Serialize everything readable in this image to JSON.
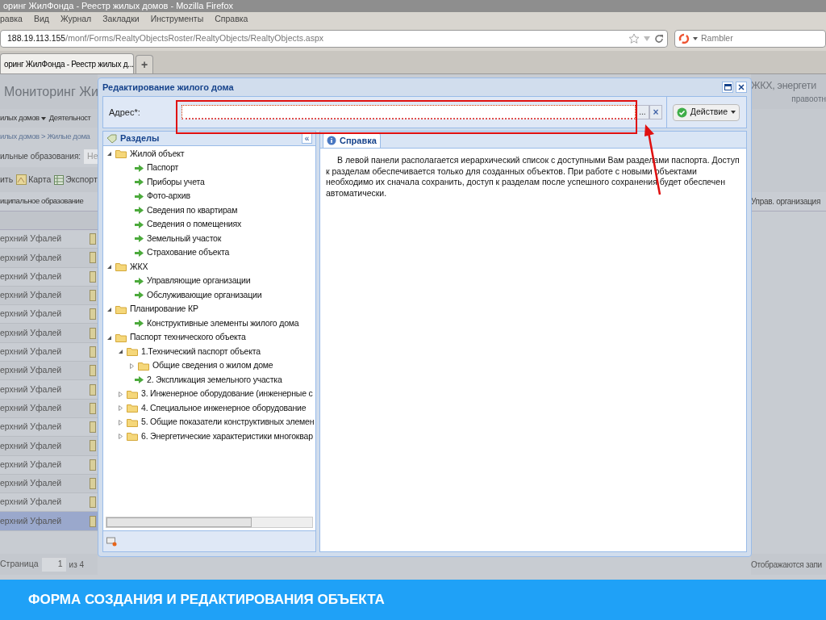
{
  "browser": {
    "title": "оринг ЖилФонда - Реестр жилых домов - Mozilla Firefox",
    "menu": [
      "равка",
      "Вид",
      "Журнал",
      "Закладки",
      "Инструменты",
      "Справка"
    ],
    "address": {
      "host": "188.19.113.155",
      "path": "/monf/Forms/RealtyObjectsRoster/RealtyObjects/RealtyObjects.aspx"
    },
    "search": {
      "engine": "Rambler"
    },
    "tabs": [
      {
        "label": "оринг ЖилФонда - Реестр жилых д...",
        "selected": true
      }
    ],
    "new_tab": "+"
  },
  "app": {
    "title": "Мониторинг Жи",
    "title_right": "ЖКХ, энергети",
    "subtitle_right": "правоотн",
    "menu": [
      {
        "label": "илых домов",
        "dropdown": true
      },
      {
        "label": "Деятельност",
        "dropdown": false
      }
    ],
    "breadcrumb": "илых домов > Жилые дома",
    "filter": {
      "label": "ильные образования:",
      "value": "Не"
    },
    "toolbar": [
      {
        "label": "ить",
        "kind": "text"
      },
      {
        "label": "Карта",
        "kind": "map"
      },
      {
        "label": "Экспорт",
        "kind": "export"
      }
    ],
    "columns": [
      "иципальное образование",
      "Управ. организация"
    ],
    "rows": [
      {
        "cell": "ерхний Уфалей",
        "selected": false
      },
      {
        "cell": "ерхний Уфалей",
        "selected": false
      },
      {
        "cell": "ерхний Уфалей",
        "selected": false
      },
      {
        "cell": "ерхний Уфалей",
        "selected": false
      },
      {
        "cell": "ерхний Уфалей",
        "selected": false
      },
      {
        "cell": "ерхний Уфалей",
        "selected": false
      },
      {
        "cell": "ерхний Уфалей",
        "selected": false
      },
      {
        "cell": "ерхний Уфалей",
        "selected": false
      },
      {
        "cell": "ерхний Уфалей",
        "selected": false
      },
      {
        "cell": "ерхний Уфалей",
        "selected": false
      },
      {
        "cell": "ерхний Уфалей",
        "selected": false
      },
      {
        "cell": "ерхний Уфалей",
        "selected": false
      },
      {
        "cell": "ерхний Уфалей",
        "selected": false
      },
      {
        "cell": "ерхний Уфалей",
        "selected": false
      },
      {
        "cell": "ерхний Уфалей",
        "selected": false
      },
      {
        "cell": "ерхний Уфалей",
        "selected": true
      }
    ],
    "pager": {
      "label": "Страница",
      "page": "1",
      "of": "из 4"
    },
    "status": "Отображаются запи"
  },
  "dialog": {
    "title": "Редактирование жилого дома",
    "address": {
      "label": "Адрес*:",
      "invalid": true,
      "browse": "...",
      "clear": "×"
    },
    "action": "Действие",
    "sections": {
      "title": "Разделы",
      "collapse": "«",
      "tree": [
        {
          "label": "Жилой объект",
          "kind": "folder",
          "expanded": true,
          "children": [
            {
              "label": "Паспорт",
              "kind": "leaf"
            },
            {
              "label": "Приборы учета",
              "kind": "leaf"
            },
            {
              "label": "Фото-архив",
              "kind": "leaf"
            },
            {
              "label": "Сведения по квартирам",
              "kind": "leaf"
            },
            {
              "label": "Сведения о помещениях",
              "kind": "leaf"
            },
            {
              "label": "Земельный участок",
              "kind": "leaf"
            },
            {
              "label": "Страхование объекта",
              "kind": "leaf"
            }
          ]
        },
        {
          "label": "ЖКХ",
          "kind": "folder",
          "expanded": true,
          "children": [
            {
              "label": "Управляющие организации",
              "kind": "leaf"
            },
            {
              "label": "Обслуживающие организации",
              "kind": "leaf"
            }
          ]
        },
        {
          "label": "Планирование КР",
          "kind": "folder",
          "expanded": true,
          "children": [
            {
              "label": "Конструктивные элементы жилого дома",
              "kind": "leaf"
            }
          ]
        },
        {
          "label": "Паспорт технического объекта",
          "kind": "folder",
          "expanded": true,
          "children": [
            {
              "label": "1.Технический паспорт объекта",
              "kind": "folder",
              "expanded": true,
              "children": [
                {
                  "label": "Общие сведения о жилом доме",
                  "kind": "folder",
                  "expanded": false
                }
              ]
            },
            {
              "label": "2. Экспликация земельного участка",
              "kind": "leaf"
            },
            {
              "label": "3. Инженерное оборудование (инженерные с",
              "kind": "folder",
              "expanded": false
            },
            {
              "label": "4. Специальное инженерное оборудование",
              "kind": "folder",
              "expanded": false
            },
            {
              "label": "5. Общие показатели конструктивных элемен",
              "kind": "folder",
              "expanded": false
            },
            {
              "label": "6. Энергетические характеристики многоквар",
              "kind": "folder",
              "expanded": false
            }
          ]
        }
      ]
    },
    "help": {
      "tab": "Справка",
      "text": "В левой панели располагается иерархический список с доступными Вам разделами паспорта. Доступ к разделам обеспечивается только для созданных объектов. При работе с новыми объектами необходимо их сначала сохранить, доступ к разделам после успешного сохранения будет обеспечен автоматически."
    }
  },
  "annotation": {
    "highlight": true,
    "arrow": true
  },
  "caption": "ФОРМА СОЗДАНИЯ И РЕДАКТИРОВАНИЯ ОБЪЕКТА"
}
